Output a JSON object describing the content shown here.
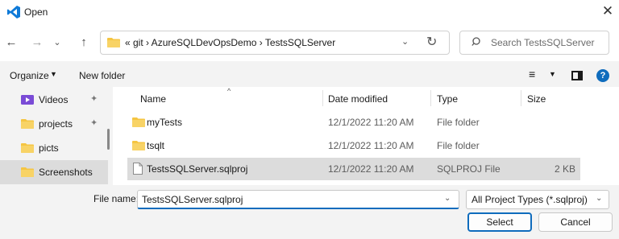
{
  "window": {
    "title": "Open",
    "close": "✕"
  },
  "nav_buttons": {
    "back": "←",
    "forward": "→",
    "recent": "⌄",
    "up": "↑"
  },
  "address": {
    "crumb_text": "«  git  ›  AzureSQLDevOpsDemo  ›  TestsSQLServer",
    "dropdown": "⌄",
    "refresh": "↻"
  },
  "search": {
    "placeholder": "Search TestsSQLServer"
  },
  "toolbar": {
    "organize": "Organize",
    "organize_caret": "▼",
    "new_folder": "New folder",
    "view_icon": "≡",
    "view_caret": "▼",
    "help": "?"
  },
  "sidebar": {
    "items": [
      {
        "label": "Videos",
        "icon": "videos-icon",
        "pin": "✦"
      },
      {
        "label": "projects",
        "icon": "folder-icon",
        "pin": "✦"
      },
      {
        "label": "picts",
        "icon": "folder-icon"
      },
      {
        "label": "Screenshots",
        "icon": "folder-icon",
        "selected": true
      }
    ]
  },
  "columns": {
    "name": "Name",
    "date": "Date modified",
    "type": "Type",
    "size": "Size",
    "sort_caret": "^"
  },
  "files": [
    {
      "name": "myTests",
      "date": "12/1/2022 11:20 AM",
      "type": "File folder",
      "size": "",
      "icon": "folder-icon"
    },
    {
      "name": "tsqlt",
      "date": "12/1/2022 11:20 AM",
      "type": "File folder",
      "size": "",
      "icon": "folder-icon"
    },
    {
      "name": "TestsSQLServer.sqlproj",
      "date": "12/1/2022 11:20 AM",
      "type": "SQLPROJ File",
      "size": "2 KB",
      "icon": "file-icon",
      "selected": true
    }
  ],
  "footer": {
    "filename_label": "File name:",
    "filename_value": "TestsSQLServer.sqlproj",
    "filename_caret": "⌄",
    "filter_value": "All Project Types (*.sqlproj)",
    "filter_caret": "⌄",
    "select_label": "Select",
    "cancel_label": "Cancel"
  },
  "colors": {
    "accent": "#0f6cbd",
    "folder": "#f5c542",
    "selection": "#dcdcdc"
  }
}
